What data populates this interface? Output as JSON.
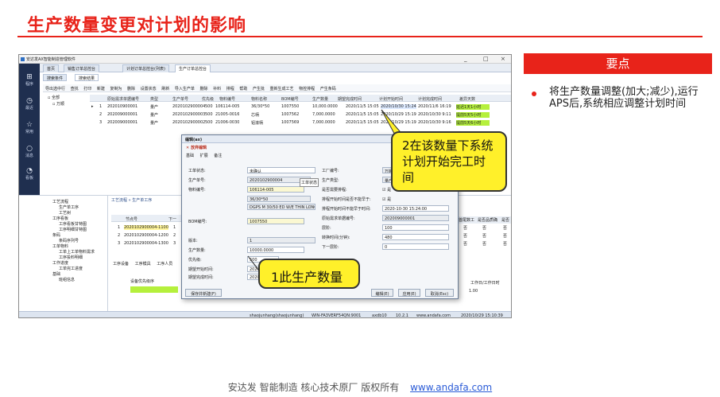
{
  "slide": {
    "title": "生产数量变更对计划的影响",
    "point_header": "要点",
    "point_text": "将生产数量调整(加大;减少),运行APS后,系统相应调整计划时间",
    "footer_text": "安达发  智能制造 核心技术原厂   版权所有",
    "footer_link": "www.andafa.com",
    "accent_color": "#e8231a"
  },
  "app": {
    "window_title": "安达发AX智能制造管理软件",
    "controls": [
      "_",
      "□",
      "×"
    ],
    "nav": [
      {
        "label": "程序",
        "icon": "grid-icon"
      },
      {
        "label": "最近",
        "icon": "clock-icon"
      },
      {
        "label": "常用",
        "icon": "star-icon"
      },
      {
        "label": "消息",
        "icon": "chat-icon"
      },
      {
        "label": "看板",
        "icon": "chart-icon"
      }
    ],
    "nav_bottom": [
      "工具",
      "退出"
    ],
    "tabs": [
      "首页",
      "销售订单总控台",
      "计划订单总控台(列表)",
      "生产订单总控台"
    ],
    "subtabs": [
      "搜索条件",
      "搜索结果"
    ],
    "tree": [
      "全部",
      "万顺"
    ],
    "toolbar": [
      "导出选中行",
      "查找",
      "打印",
      "新建",
      "复制为",
      "删除",
      "设置状态",
      "刷新",
      "导入生产单",
      "删除",
      "补料",
      "排程",
      "帮助",
      "产生批",
      "重新生成工艺",
      "物控排程",
      "产生条码"
    ],
    "grid_headers": [
      "原始需求单据编号",
      "类型",
      "生产单号",
      "优先级",
      "物料编号",
      "物料名称",
      "BOM编号",
      "生产数量",
      "期望完成时间",
      "计划开始时间",
      "计划完成时间",
      "差异天数"
    ],
    "grid_rows": [
      {
        "no": "1",
        "order": "202010900001",
        "type": "量产",
        "prod": "2020102900004",
        "prio": "500",
        "item": "106114-005",
        "name": "36/30*50",
        "bom": "1007550",
        "qty": "10,000.0000",
        "due": "2020/11/5 15:05",
        "start": "2020/10/30 15:24",
        "end": "2020/11/6 16:19",
        "diff": "延迟1天1小时"
      },
      {
        "no": "2",
        "order": "202009000001",
        "type": "量产",
        "prod": "2020102900003",
        "prio": "500",
        "item": "21005-0016",
        "name": "芯柄",
        "bom": "1007562",
        "qty": "7,000.0000",
        "due": "2020/11/5 15:05",
        "start": "2020/10/29 15:19",
        "end": "2020/10/30 9:11",
        "diff": "提前5天5小时"
      },
      {
        "no": "3",
        "order": "202009000001",
        "type": "量产",
        "prod": "2020102900002",
        "prio": "500",
        "item": "21006-0030",
        "name": "铝滚柄",
        "bom": "1007569",
        "qty": "7,000.0000",
        "due": "2020/11/5 15:05",
        "start": "2020/10/29 15:19",
        "end": "2020/10/30 9:16",
        "diff": "提前5天6小时"
      }
    ],
    "lower_tree": [
      "工艺流程",
      "生产单工序",
      "工艺树",
      "工序看板",
      "工序看板甘特图",
      "工序明细甘特图",
      "条码",
      "条码序列号",
      "工单物料",
      "工单上工单物料需求",
      "工序投料明细",
      "工作进度",
      "工单完工进度",
      "基础",
      "班组信息"
    ],
    "lower_tabs": [
      "工艺流程",
      "生产单工序"
    ],
    "lower_headers": [
      "节点号",
      "下一"
    ],
    "lower_rows": [
      {
        "no": "1",
        "node": "2020102900004-1100",
        "next": "1"
      },
      {
        "no": "2",
        "node": "2020102900004-1200",
        "next": "2"
      },
      {
        "no": "3",
        "node": "2020102900004-1300",
        "next": "3"
      }
    ],
    "lower_tabs2": [
      "工序设备",
      "工序模具",
      "工序人员"
    ],
    "lower_header2": "设备优先级序",
    "lower_right_headers": [
      "首尾数工",
      "是否品质确",
      "是否"
    ],
    "lower_right_rows": [
      [
        "否",
        "否",
        "否"
      ],
      [
        "否",
        "否",
        "否"
      ],
      [
        "否",
        "否",
        "否"
      ]
    ],
    "bottom_right_label": "工作日/工作日时",
    "bottom_right_val": "1.00",
    "statusbar": {
      "user": "shaojunhang(shaojunhang)",
      "host": "WIN-FA3VERF54QN:9001",
      "db": "axdb10",
      "ver": "10.2.1",
      "site": "www.andafa.com",
      "time": "2020/10/29 15:10:39"
    }
  },
  "dialog": {
    "title": "编辑(ax)",
    "menu": "放弃编辑",
    "tabs": [
      "基础",
      "扩展",
      "备注"
    ],
    "left_fields": [
      {
        "label": "工单状态:",
        "value": "未确认"
      },
      {
        "label": "生产单号:",
        "value": "2020102900004"
      },
      {
        "label": "物料编号:",
        "value": "106114-005"
      },
      {
        "label": "",
        "value": "36/30*50"
      },
      {
        "label": "",
        "value": "DGPS M 30/50 ED W/E THIN LONG HM"
      },
      {
        "label": "BOM编号:",
        "value": "1007550"
      },
      {
        "label": "版本:",
        "value": "1"
      },
      {
        "label": "生产数量:",
        "value": "10000.0000"
      },
      {
        "label": "优先级:",
        "value": "500"
      },
      {
        "label": "期望开始时间:",
        "value": "2020-11-02"
      },
      {
        "label": "期望完成时间:",
        "value": "2020-11-05"
      }
    ],
    "right_fields": [
      {
        "label": "工厂编号:",
        "value": "万顺"
      },
      {
        "label": "生产类型:",
        "value": "量产"
      },
      {
        "label": "是否需要排程:",
        "value": "是"
      },
      {
        "label": "排程开始时间是否不能早于:",
        "value": "是"
      },
      {
        "label": "排程开始时间不能早于时间:",
        "value": "2020-10-30 15:24:00"
      },
      {
        "label": "原始需求单据编号:",
        "value": "202009000001"
      },
      {
        "label": "层阶:",
        "value": "100"
      },
      {
        "label": "转换时间(分钟):",
        "value": "480"
      },
      {
        "label": "下一层阶:",
        "value": "0"
      }
    ],
    "tooltip": "工单状态",
    "save_label": "保存并新建(F)",
    "btn_edit": "编辑(E)",
    "btn_apply": "应用(E)",
    "btn_cancel": "取消(Esc)"
  },
  "callouts": {
    "c1": "2在该数量下系统计划开始完工时间",
    "c2": "1此生产数量"
  }
}
